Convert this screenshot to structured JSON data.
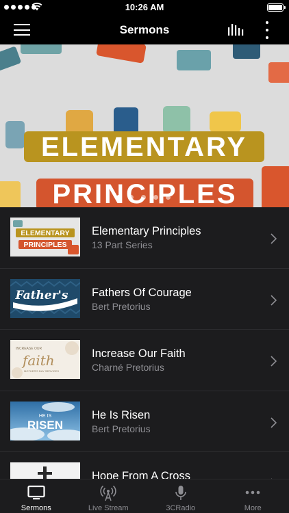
{
  "status_bar": {
    "time": "10:26 AM"
  },
  "nav": {
    "title": "Sermons"
  },
  "banner": {
    "title_line1": "ELEMENTARY",
    "title_line2": "PRINCIPLES",
    "page_count": 5,
    "active_page": 1
  },
  "sermons": [
    {
      "title": "Elementary Principles",
      "subtitle": "13 Part Series",
      "thumb_text": [
        "ELEMENTARY",
        "PRINCIPLES"
      ]
    },
    {
      "title": "Fathers Of Courage",
      "subtitle": "Bert Pretorius",
      "thumb_text": [
        "Father's"
      ]
    },
    {
      "title": "Increase Our Faith",
      "subtitle": "Charné Pretorius",
      "thumb_text": [
        "INCREASE OUR",
        "faith",
        "MOTHER'S DAY SERVICES"
      ]
    },
    {
      "title": "He Is Risen",
      "subtitle": "Bert Pretorius",
      "thumb_text": [
        "HE IS",
        "RISEN"
      ]
    },
    {
      "title": "Hope From A Cross",
      "subtitle": ""
    }
  ],
  "tabs": [
    {
      "label": "Sermons",
      "icon": "tv-icon",
      "active": true
    },
    {
      "label": "Live Stream",
      "icon": "broadcast-icon",
      "active": false
    },
    {
      "label": "3CRadio",
      "icon": "microphone-icon",
      "active": false
    },
    {
      "label": "More",
      "icon": "more-dots-icon",
      "active": false
    }
  ],
  "colors": {
    "banner_gold": "#b9941f",
    "banner_orange": "#d4552e",
    "list_background": "#1c1c1e",
    "subtitle_gray": "#8e8e93"
  }
}
